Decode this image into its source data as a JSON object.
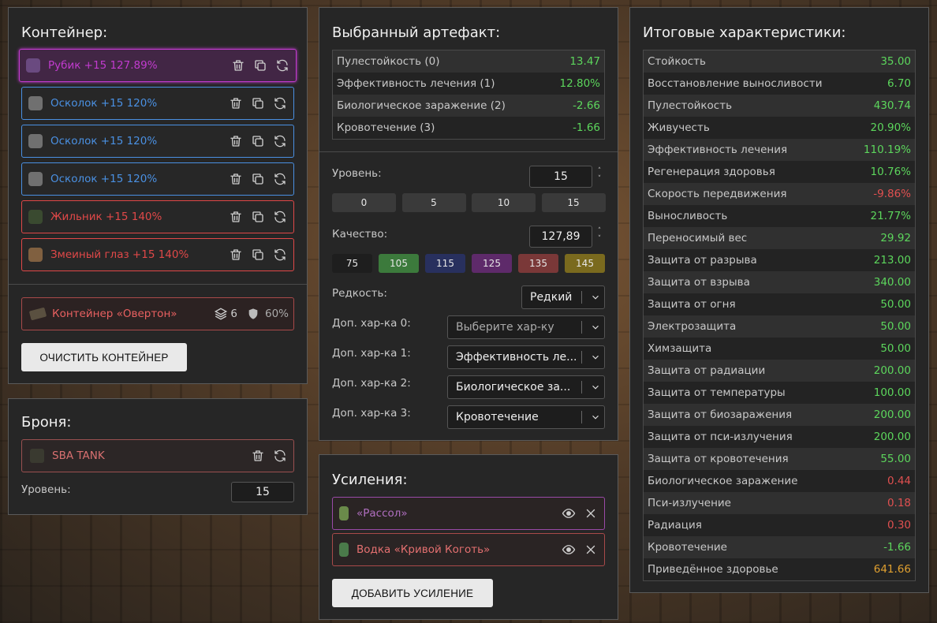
{
  "container": {
    "title": "Контейнер:",
    "items": [
      {
        "name": "Рубик +15 127.89%",
        "color": "#c23bcf"
      },
      {
        "name": "Осколок +15 120%",
        "color": "#4a90e2"
      },
      {
        "name": "Осколок +15 120%",
        "color": "#4a90e2"
      },
      {
        "name": "Осколок +15 120%",
        "color": "#4a90e2"
      },
      {
        "name": "Жильник +15 140%",
        "color": "#e04848"
      },
      {
        "name": "Змеиный глаз +15 140%",
        "color": "#e04848"
      }
    ],
    "selected": {
      "name": "Контейнер «Овертон»",
      "slots": "6",
      "protection": "60%"
    },
    "clear_button": "ОЧИСТИТЬ КОНТЕЙНЕР"
  },
  "armor": {
    "title": "Броня:",
    "name": "SBA TANK",
    "level_label": "Уровень:",
    "level": "15"
  },
  "artifact": {
    "title": "Выбранный артефакт:",
    "stats": [
      {
        "name": "Пулестойкость (0)",
        "value": "13.47",
        "color": "#5cd65c"
      },
      {
        "name": "Эффективность лечения (1)",
        "value": "12.80%",
        "color": "#5cd65c"
      },
      {
        "name": "Биологическое заражение (2)",
        "value": "-2.66",
        "color": "#5cd65c"
      },
      {
        "name": "Кровотечение (3)",
        "value": "-1.66",
        "color": "#5cd65c"
      }
    ],
    "level_label": "Уровень:",
    "level": "15",
    "level_presets": [
      "0",
      "5",
      "10",
      "15"
    ],
    "quality_label": "Качество:",
    "quality": "127,89",
    "quality_presets": [
      {
        "label": "75",
        "color": "#1e1e1e"
      },
      {
        "label": "105",
        "color": "#3c7a3c"
      },
      {
        "label": "115",
        "color": "#28305e"
      },
      {
        "label": "125",
        "color": "#5e2a6a"
      },
      {
        "label": "135",
        "color": "#7a3838"
      },
      {
        "label": "145",
        "color": "#7a6a1e"
      }
    ],
    "rarity_label": "Редкость:",
    "rarity": "Редкий",
    "extra": [
      {
        "label": "Доп. хар-ка 0:",
        "value": "Выберите хар-ку",
        "placeholder": true
      },
      {
        "label": "Доп. хар-ка 1:",
        "value": "Эффективность ле..."
      },
      {
        "label": "Доп. хар-ка 2:",
        "value": "Биологическое за..."
      },
      {
        "label": "Доп. хар-ка 3:",
        "value": "Кровотечение"
      }
    ]
  },
  "boosts": {
    "title": "Усиления:",
    "items": [
      {
        "name": "«Рассол»",
        "color": "#b06fc0",
        "border": "#9a4aa8"
      },
      {
        "name": "Водка «Кривой Коготь»",
        "color": "#e47070",
        "border": "#a84a4a"
      }
    ],
    "add_button": "ДОБАВИТЬ УСИЛЕНИЕ"
  },
  "totals": {
    "title": "Итоговые характеристики:",
    "stats": [
      {
        "name": "Стойкость",
        "value": "35.00",
        "color": "#5cd65c"
      },
      {
        "name": "Восстановление выносливости",
        "value": "6.70",
        "color": "#5cd65c"
      },
      {
        "name": "Пулестойкость",
        "value": "430.74",
        "color": "#5cd65c"
      },
      {
        "name": "Живучесть",
        "value": "20.90%",
        "color": "#5cd65c"
      },
      {
        "name": "Эффективность лечения",
        "value": "110.19%",
        "color": "#5cd65c"
      },
      {
        "name": "Регенерация здоровья",
        "value": "10.76%",
        "color": "#5cd65c"
      },
      {
        "name": "Скорость передвижения",
        "value": "-9.86%",
        "color": "#e05050"
      },
      {
        "name": "Выносливость",
        "value": "21.77%",
        "color": "#5cd65c"
      },
      {
        "name": "Переносимый вес",
        "value": "29.92",
        "color": "#5cd65c"
      },
      {
        "name": "Защита от разрыва",
        "value": "213.00",
        "color": "#5cd65c"
      },
      {
        "name": "Защита от взрыва",
        "value": "340.00",
        "color": "#5cd65c"
      },
      {
        "name": "Защита от огня",
        "value": "50.00",
        "color": "#5cd65c"
      },
      {
        "name": "Электрозащита",
        "value": "50.00",
        "color": "#5cd65c"
      },
      {
        "name": "Химзащита",
        "value": "50.00",
        "color": "#5cd65c"
      },
      {
        "name": "Защита от радиации",
        "value": "200.00",
        "color": "#5cd65c"
      },
      {
        "name": "Защита от температуры",
        "value": "100.00",
        "color": "#5cd65c"
      },
      {
        "name": "Защита от биозаражения",
        "value": "200.00",
        "color": "#5cd65c"
      },
      {
        "name": "Защита от пси-излучения",
        "value": "200.00",
        "color": "#5cd65c"
      },
      {
        "name": "Защита от кровотечения",
        "value": "55.00",
        "color": "#5cd65c"
      },
      {
        "name": "Биологическое заражение",
        "value": "0.44",
        "color": "#e05050"
      },
      {
        "name": "Пси-излучение",
        "value": "0.18",
        "color": "#e05050"
      },
      {
        "name": "Радиация",
        "value": "0.30",
        "color": "#e05050"
      },
      {
        "name": "Кровотечение",
        "value": "-1.66",
        "color": "#5cd65c"
      },
      {
        "name": "Приведённое здоровье",
        "value": "641.66",
        "color": "#e0a030"
      }
    ]
  }
}
